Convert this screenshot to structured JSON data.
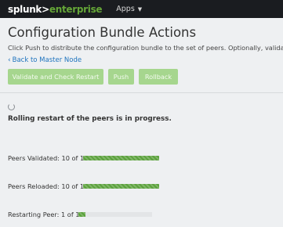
{
  "colors": {
    "topbar": "#1a1c20",
    "brand_green": "#65a637",
    "button_disabled": "#a6d68e",
    "progress_fill": "#5ca23e",
    "link": "#1e73be"
  },
  "header": {
    "logo_part1": "splunk>",
    "logo_part2": "enterprise",
    "apps_label": "Apps",
    "apps_icon": "caret-down-icon"
  },
  "page": {
    "title": "Configuration Bundle Actions",
    "description": "Click Push to distribute the configuration bundle to the set of peers. Optionally, validate the bun",
    "back_link": "Back to Master Node",
    "back_icon": "chevron-left-icon"
  },
  "actions": {
    "validate": "Validate and Check Restart",
    "push": "Push",
    "rollback": "Rollback"
  },
  "status": {
    "spinner_icon": "loading-spinner-icon",
    "message": "Rolling restart of the peers is in progress."
  },
  "progress": [
    {
      "label": "Peers Validated: 10 of 10",
      "fraction": 1.0
    },
    {
      "label": "Peers Reloaded: 10 of 10",
      "fraction": 1.0
    },
    {
      "label": "Restarting Peer: 1 of 10",
      "fraction": 0.1
    }
  ]
}
